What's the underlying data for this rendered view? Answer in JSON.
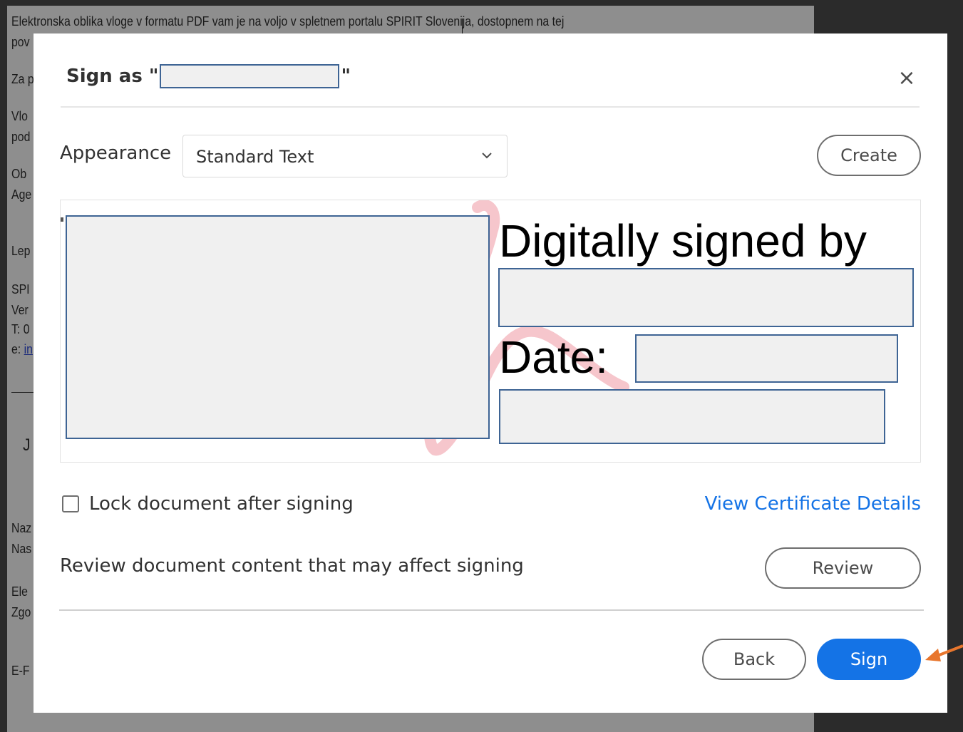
{
  "background_document": {
    "lines": [
      "Elektronska oblika vloge v formatu PDF vam je na voljo v spletnem portalu SPIRIT Slovenija, dostopnem na tej",
      "pov",
      "Za p",
      "Vlo",
      "pod",
      "Ob",
      "Age",
      "Lep",
      "SPI",
      "Ver",
      "T: 0",
      "e: ",
      "J",
      "Naz",
      "Nas",
      "Ele",
      "Zgo",
      "E-F"
    ],
    "link_text": "in"
  },
  "dialog": {
    "title_prefix": "Sign as \"",
    "title_suffix": "\"",
    "appearance_label": "Appearance",
    "appearance_value": "Standard Text",
    "create_label": "Create",
    "preview": {
      "digitally_signed_by": "Digitally signed by",
      "date_label": "Date:"
    },
    "lock_label": "Lock document after signing",
    "lock_checked": false,
    "view_certificate_label": "View Certificate Details",
    "review_text": "Review document content that may affect signing",
    "review_label": "Review",
    "back_label": "Back",
    "sign_label": "Sign"
  },
  "colors": {
    "accent": "#1473e6",
    "annotation_arrow": "#e8762d",
    "redaction_border": "#3e6494",
    "redaction_fill": "#f0f0f0"
  }
}
